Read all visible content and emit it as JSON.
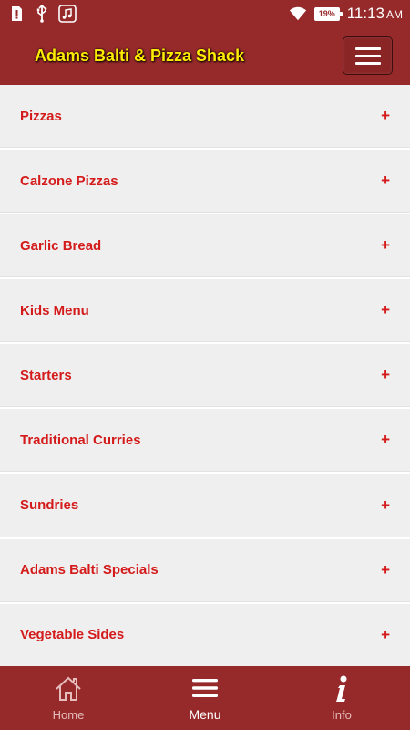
{
  "status_bar": {
    "battery_percent": "19%",
    "time": "11:13",
    "ampm": "AM"
  },
  "header": {
    "title": "Adams Balti & Pizza Shack"
  },
  "menu_categories": [
    {
      "label": "Pizzas",
      "expand": "+"
    },
    {
      "label": "Calzone Pizzas",
      "expand": "+"
    },
    {
      "label": "Garlic Bread",
      "expand": "+"
    },
    {
      "label": "Kids Menu",
      "expand": "+"
    },
    {
      "label": "Starters",
      "expand": "+"
    },
    {
      "label": "Traditional Curries",
      "expand": "+"
    },
    {
      "label": "Sundries",
      "expand": "+"
    },
    {
      "label": "Adams Balti Specials",
      "expand": "+"
    },
    {
      "label": "Vegetable Sides",
      "expand": "+"
    }
  ],
  "bottom_nav": {
    "home_label": "Home",
    "menu_label": "Menu",
    "info_label": "Info",
    "active": "Menu"
  },
  "colors": {
    "brand": "#962a2b",
    "title_text": "#ffeb00",
    "item_text": "#d41a1a",
    "item_background": "#efefef"
  }
}
